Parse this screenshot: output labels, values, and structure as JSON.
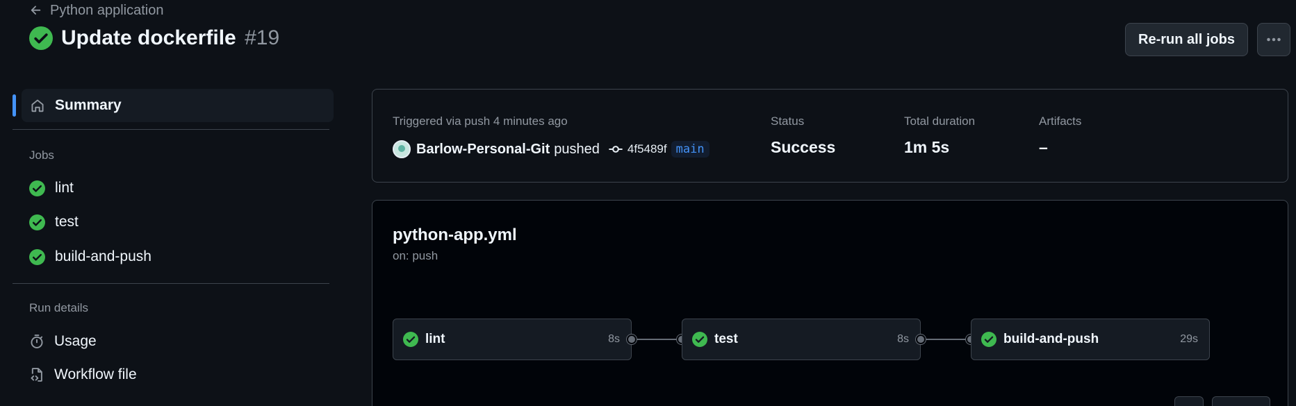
{
  "header": {
    "back_label": "Python application",
    "title": "Update dockerfile",
    "run_number": "#19",
    "rerun_label": "Re-run all jobs"
  },
  "sidebar": {
    "summary_label": "Summary",
    "jobs_heading": "Jobs",
    "jobs": [
      {
        "label": "lint",
        "status": "success"
      },
      {
        "label": "test",
        "status": "success"
      },
      {
        "label": "build-and-push",
        "status": "success"
      }
    ],
    "run_details_heading": "Run details",
    "usage_label": "Usage",
    "workflow_file_label": "Workflow file"
  },
  "summary": {
    "trigger_text": "Triggered via push 4 minutes ago",
    "actor": "Barlow-Personal-Git",
    "action": "pushed",
    "sha": "4f5489f",
    "branch": "main",
    "status_label": "Status",
    "status_value": "Success",
    "duration_label": "Total duration",
    "duration_value": "1m 5s",
    "artifacts_label": "Artifacts",
    "artifacts_value": "–"
  },
  "workflow": {
    "name": "python-app.yml",
    "trigger": "on: push",
    "jobs": [
      {
        "name": "lint",
        "duration": "8s"
      },
      {
        "name": "test",
        "duration": "8s"
      },
      {
        "name": "build-and-push",
        "duration": "29s"
      }
    ]
  },
  "colors": {
    "success": "#3fb950",
    "accent": "#4493f8",
    "background": "#0d1117"
  }
}
